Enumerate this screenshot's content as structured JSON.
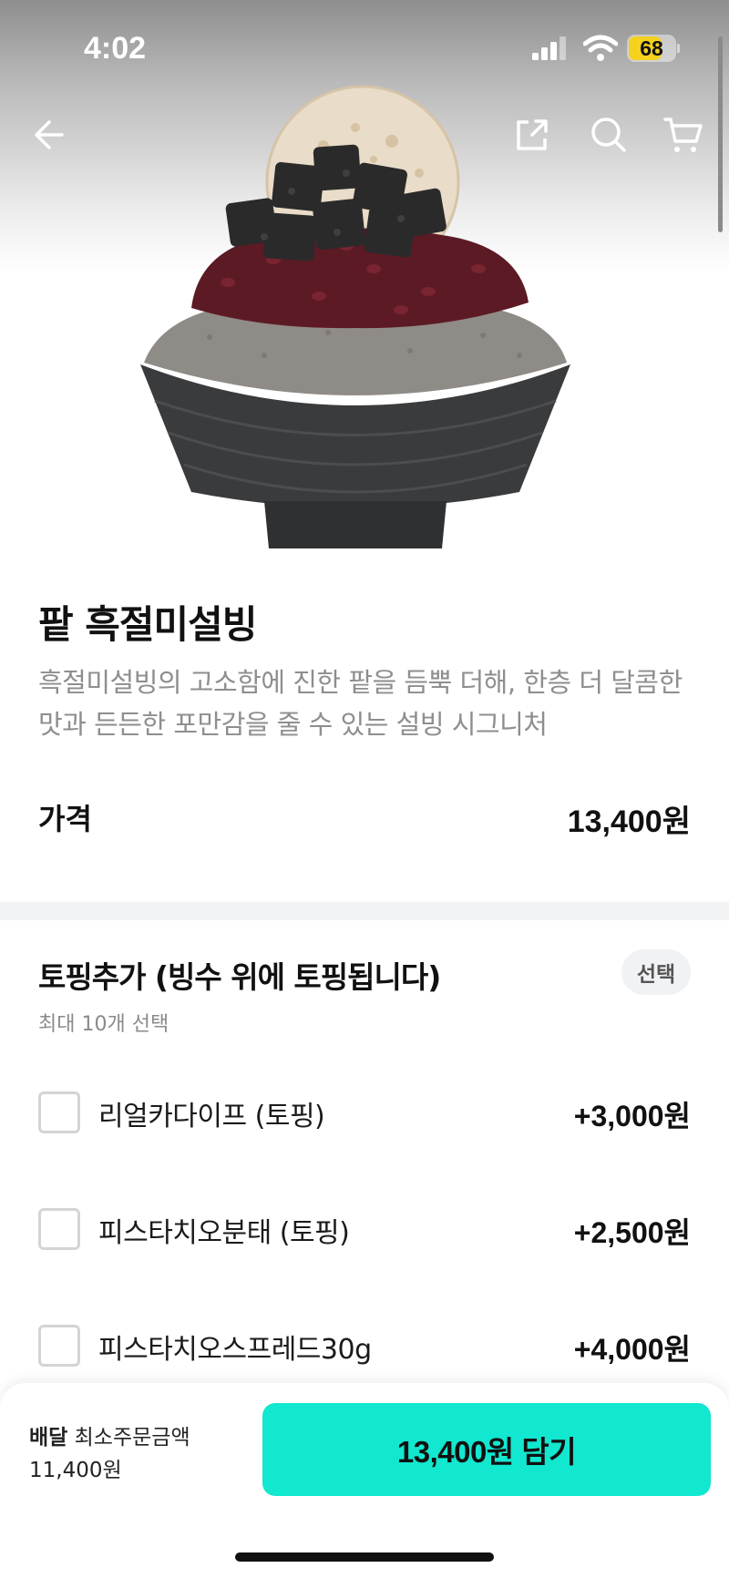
{
  "status_bar": {
    "time": "4:02",
    "battery": "68"
  },
  "product": {
    "name": "팥 흑절미설빙",
    "description": "흑절미설빙의 고소함에 진한 팥을 듬뿍 더해, 한층 더 달콤한 맛과 든든한 포만감을 줄 수 있는 설빙 시그니처",
    "price_label": "가격",
    "price": "13,400원"
  },
  "options": {
    "title": "토핑추가 (빙수 위에 토핑됩니다)",
    "badge": "선택",
    "subtitle": "최대 10개 선택",
    "items": [
      {
        "name": "리얼카다이프 (토핑)",
        "price": "+3,000원"
      },
      {
        "name": "피스타치오분태 (토핑)",
        "price": "+2,500원"
      },
      {
        "name": "피스타치오스프레드30g",
        "price": "+4,000원"
      }
    ]
  },
  "bottom_bar": {
    "delivery_label": "배달",
    "min_order_label": "최소주문금액",
    "min_order_amount": "11,400원",
    "add_button": "13,400원 담기"
  },
  "colors": {
    "accent": "#12e7cf",
    "battery": "#f5d21e",
    "muted_text": "#8e8e8e"
  },
  "icons": [
    "back-arrow-icon",
    "share-icon",
    "search-icon",
    "cart-icon",
    "checkbox-icon",
    "signal-icon",
    "wifi-icon",
    "battery-icon"
  ]
}
